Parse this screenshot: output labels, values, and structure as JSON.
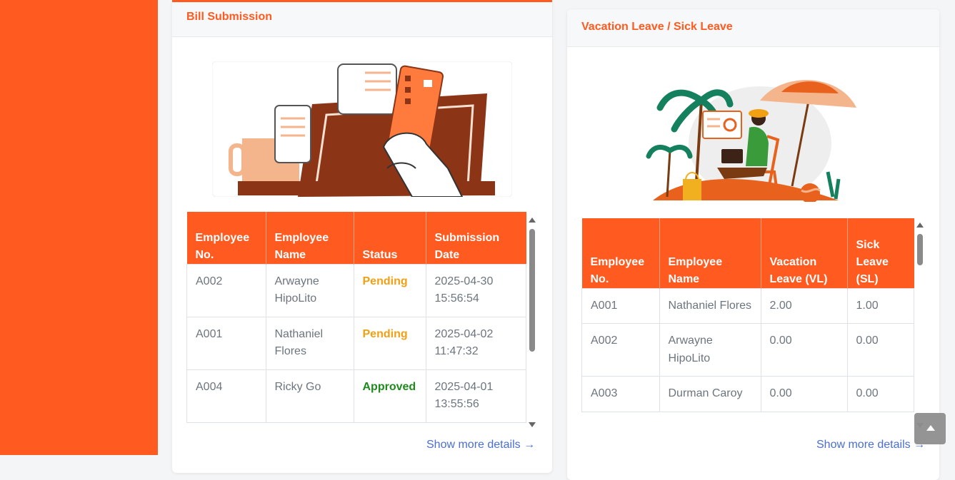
{
  "bill": {
    "title": "Bill Submission",
    "headers": [
      "Employee No.",
      "Employee Name",
      "Status",
      "Submission Date"
    ],
    "rows": [
      {
        "no": "A002",
        "name": "Arwayne HipoLito",
        "status": "Pending",
        "date": "2025-04-30 15:56:54"
      },
      {
        "no": "A001",
        "name": "Nathaniel Flores",
        "status": "Pending",
        "date": "2025-04-02 11:47:32"
      },
      {
        "no": "A004",
        "name": "Ricky Go",
        "status": "Approved",
        "date": "2025-04-01 13:55:56"
      }
    ],
    "more": "Show more details →"
  },
  "leave": {
    "title": "Vacation Leave / Sick Leave",
    "headers": [
      "Employee No.",
      "Employee Name",
      "Vacation Leave (VL)",
      "Sick Leave (SL)"
    ],
    "rows": [
      {
        "no": "A001",
        "name": "Nathaniel Flores",
        "vl": "2.00",
        "sl": "1.00"
      },
      {
        "no": "A002",
        "name": "Arwayne HipoLito",
        "vl": "0.00",
        "sl": "0.00"
      },
      {
        "no": "A003",
        "name": "Durman Caroy",
        "vl": "0.00",
        "sl": "0.00"
      }
    ],
    "more": "Show more details →"
  },
  "icons": {
    "back_to_top": "chevron-up-icon",
    "bill_illustration": "payment-card-illustration",
    "leave_illustration": "beach-vacation-illustration"
  },
  "colors": {
    "accent": "#ff5a1f",
    "pending": "#f0a012",
    "approved": "#1e8a1e",
    "link": "#4a6fd1"
  }
}
